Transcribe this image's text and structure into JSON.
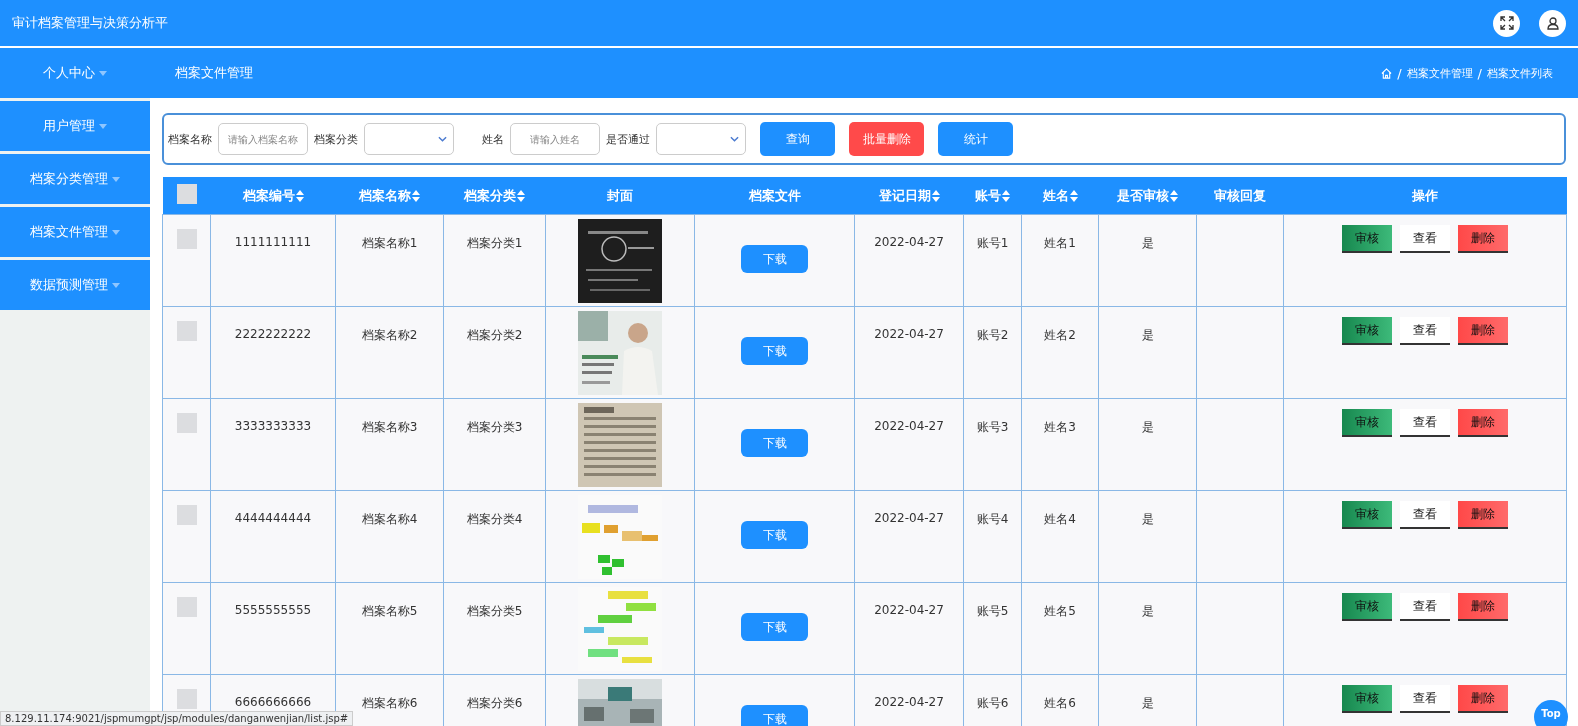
{
  "app": {
    "title": "审计档案管理与决策分析平"
  },
  "sidebar": {
    "items": [
      {
        "label": "个人中心"
      },
      {
        "label": "用户管理"
      },
      {
        "label": "档案分类管理"
      },
      {
        "label": "档案文件管理"
      },
      {
        "label": "数据预测管理"
      }
    ]
  },
  "page": {
    "title": "档案文件管理",
    "breadcrumb": [
      {
        "kind": "separator",
        "text": "/"
      },
      {
        "kind": "link",
        "text": "档案文件管理"
      },
      {
        "kind": "separator",
        "text": "/"
      },
      {
        "kind": "link",
        "text": "档案文件列表"
      }
    ]
  },
  "search": {
    "fields": [
      {
        "kind": "input",
        "label": "档案名称",
        "placeholder": "请输入档案名称"
      },
      {
        "kind": "select",
        "label": "档案分类"
      },
      {
        "kind": "input",
        "label": "姓名",
        "placeholder": "请输入姓名"
      },
      {
        "kind": "select",
        "label": "是否通过"
      }
    ],
    "buttons": [
      {
        "label": "查询",
        "kind": "primary"
      },
      {
        "label": "批量删除",
        "kind": "danger"
      },
      {
        "label": "统计",
        "kind": "primary"
      }
    ]
  },
  "table": {
    "header_checked": false,
    "columns": [
      {
        "label": "档案编号",
        "sortable": true
      },
      {
        "label": "档案名称",
        "sortable": true
      },
      {
        "label": "档案分类",
        "sortable": true
      },
      {
        "label": "封面",
        "sortable": false
      },
      {
        "label": "档案文件",
        "sortable": false
      },
      {
        "label": "登记日期",
        "sortable": true
      },
      {
        "label": "账号",
        "sortable": true
      },
      {
        "label": "姓名",
        "sortable": true
      },
      {
        "label": "是否审核",
        "sortable": true
      },
      {
        "label": "审核回复",
        "sortable": false
      },
      {
        "label": "操作",
        "sortable": false
      }
    ],
    "rows": [
      {
        "checked": false,
        "number": "1111111111",
        "name": "档案名称1",
        "category": "档案分类1",
        "file": "下载",
        "date": "2022-04-27",
        "account": "账号1",
        "person": "姓名1",
        "audited": "是",
        "actions": [
          {
            "label": "审核",
            "kind": "audit"
          },
          {
            "label": "查看",
            "kind": "view"
          },
          {
            "label": "删除",
            "kind": "delete"
          }
        ]
      },
      {
        "checked": false,
        "number": "2222222222",
        "name": "档案名称2",
        "category": "档案分类2",
        "file": "下载",
        "date": "2022-04-27",
        "account": "账号2",
        "person": "姓名2",
        "audited": "是",
        "actions": [
          {
            "label": "审核",
            "kind": "audit"
          },
          {
            "label": "查看",
            "kind": "view"
          },
          {
            "label": "删除",
            "kind": "delete"
          }
        ]
      },
      {
        "checked": false,
        "number": "3333333333",
        "name": "档案名称3",
        "category": "档案分类3",
        "file": "下载",
        "date": "2022-04-27",
        "account": "账号3",
        "person": "姓名3",
        "audited": "是",
        "actions": [
          {
            "label": "审核",
            "kind": "audit"
          },
          {
            "label": "查看",
            "kind": "view"
          },
          {
            "label": "删除",
            "kind": "delete"
          }
        ]
      },
      {
        "checked": false,
        "number": "4444444444",
        "name": "档案名称4",
        "category": "档案分类4",
        "file": "下载",
        "date": "2022-04-27",
        "account": "账号4",
        "person": "姓名4",
        "audited": "是",
        "actions": [
          {
            "label": "审核",
            "kind": "audit"
          },
          {
            "label": "查看",
            "kind": "view"
          },
          {
            "label": "删除",
            "kind": "delete"
          }
        ]
      },
      {
        "checked": false,
        "number": "5555555555",
        "name": "档案名称5",
        "category": "档案分类5",
        "file": "下载",
        "date": "2022-04-27",
        "account": "账号5",
        "person": "姓名5",
        "audited": "是",
        "actions": [
          {
            "label": "审核",
            "kind": "audit"
          },
          {
            "label": "查看",
            "kind": "view"
          },
          {
            "label": "删除",
            "kind": "delete"
          }
        ]
      },
      {
        "checked": false,
        "number": "6666666666",
        "name": "档案名称6",
        "category": "档案分类6",
        "file": "下载",
        "date": "2022-04-27",
        "account": "账号6",
        "person": "姓名6",
        "audited": "是",
        "actions": [
          {
            "label": "审核",
            "kind": "audit"
          },
          {
            "label": "查看",
            "kind": "view"
          },
          {
            "label": "删除",
            "kind": "delete"
          }
        ]
      }
    ]
  },
  "status_url": "8.129.11.174:9021/jspmumgpt/jsp/modules/danganwenjian/list.jsp#",
  "top_button": "Top"
}
